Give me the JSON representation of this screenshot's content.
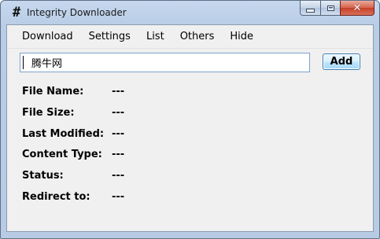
{
  "window": {
    "title": "Integrity Downloader",
    "icon": "hash-icon",
    "caption_buttons": [
      "minimize",
      "maximize",
      "close"
    ]
  },
  "menu": {
    "items": [
      "Download",
      "Settings",
      "List",
      "Others",
      "Hide"
    ]
  },
  "url_input": {
    "value": "腾牛网",
    "placeholder": ""
  },
  "add_button": {
    "label": "Add"
  },
  "info": [
    {
      "label": "File Name:",
      "value": "---"
    },
    {
      "label": "File Size:",
      "value": "---"
    },
    {
      "label": "Last Modified:",
      "value": "---"
    },
    {
      "label": "Content Type:",
      "value": "---"
    },
    {
      "label": "Status:",
      "value": "---"
    },
    {
      "label": "Redirect to:",
      "value": "---"
    }
  ],
  "colors": {
    "frame": "#b9cde6",
    "client_bg": "#f0f0f0",
    "close_button": "#c44026",
    "input_border": "#7da2ce",
    "button_border": "#3c7fb1"
  }
}
